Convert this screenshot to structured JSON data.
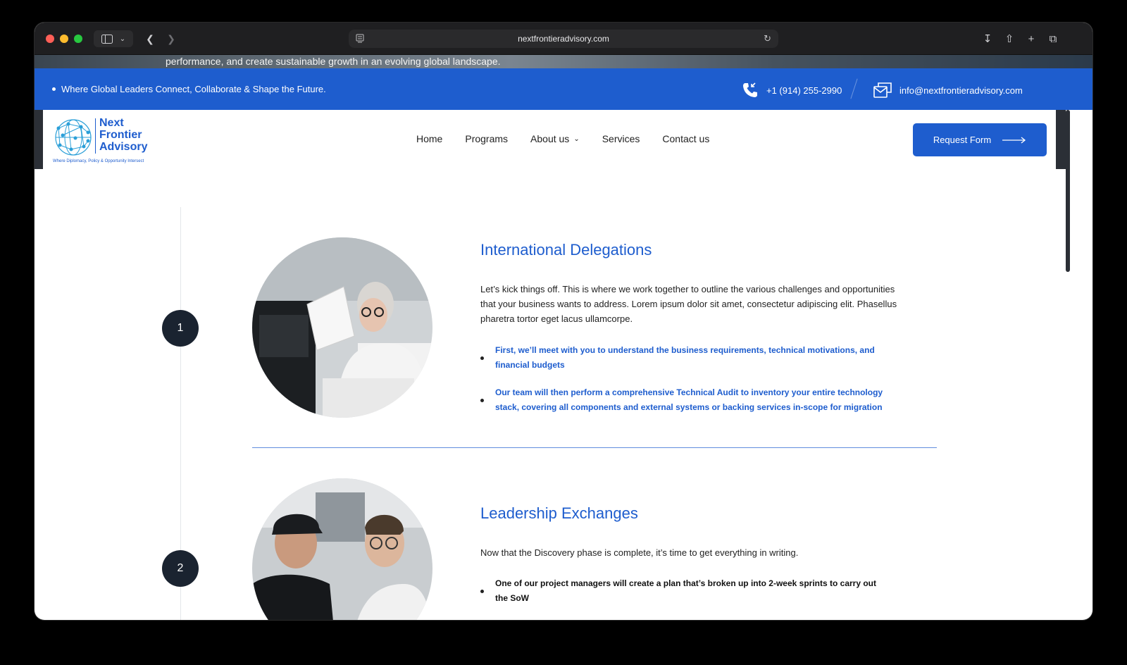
{
  "browser": {
    "url": "nextfrontieradvisory.com"
  },
  "hero": {
    "text": "performance, and create sustainable growth in an evolving global landscape."
  },
  "topbar": {
    "tagline": "Where Global Leaders Connect, Collaborate & Shape the Future.",
    "phone": "+1 (914) 255-2990",
    "email": "info@nextfrontieradvisory.com"
  },
  "logo": {
    "line1": "Next",
    "line2": "Frontier",
    "line3": "Advisory",
    "tagline": "Where Diplomacy, Policy & Opportunity Intersect"
  },
  "nav": {
    "items": [
      {
        "label": "Home"
      },
      {
        "label": "Programs"
      },
      {
        "label": "About us"
      },
      {
        "label": "Services"
      },
      {
        "label": "Contact us"
      }
    ],
    "cta": "Request Form"
  },
  "steps": [
    {
      "number": "1",
      "title": "International Delegations",
      "body": "Let’s kick things off. This is where we work together to outline the various challenges and opportunities that your business wants to address. Lorem ipsum dolor sit amet, consectetur adipiscing elit. Phasellus pharetra tortor eget lacus ullamcorpe.",
      "bullets": [
        "First, we’ll meet with you to understand the business requirements, technical motivations, and financial budgets",
        "Our team will then perform a comprehensive Technical Audit to inventory your entire technology stack, covering all components and external systems or backing services in-scope for migration"
      ]
    },
    {
      "number": "2",
      "title": "Leadership Exchanges",
      "body": "Now that the Discovery phase is complete, it’s time to get everything in writing.",
      "bullets": [
        "One of our project managers will create a plan that’s broken up into 2-week sprints to carry out the SoW"
      ]
    }
  ],
  "colors": {
    "brand_blue": "#1e5dce",
    "step_circle": "#1a2330"
  }
}
